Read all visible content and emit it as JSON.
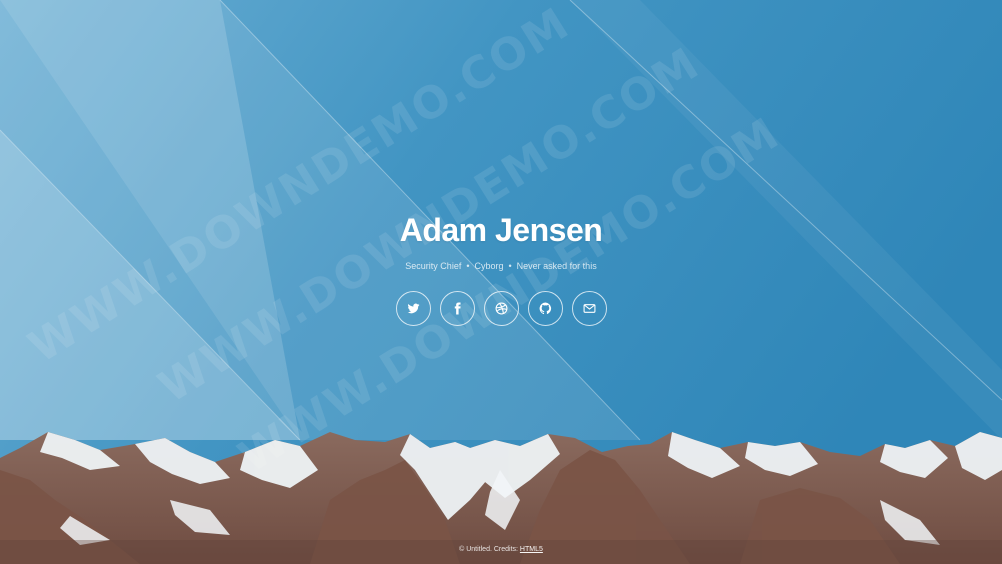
{
  "profile": {
    "name": "Adam Jensen",
    "tagline": [
      "Security Chief",
      "Cyborg",
      "Never asked for this"
    ]
  },
  "socials": [
    {
      "icon": "twitter-icon"
    },
    {
      "icon": "facebook-icon"
    },
    {
      "icon": "dribbble-icon"
    },
    {
      "icon": "github-icon"
    },
    {
      "icon": "mail-icon"
    }
  ],
  "footer": {
    "text": "© Untitled. Credits:",
    "link_label": "HTML5"
  },
  "watermark": "WWW.DOWNDEMO.COM",
  "colors": {
    "sky_top": "#3a8cbc",
    "sky_light": "#a9d0e6",
    "rock": "#7d5a4e",
    "snow": "#eef3f6"
  }
}
